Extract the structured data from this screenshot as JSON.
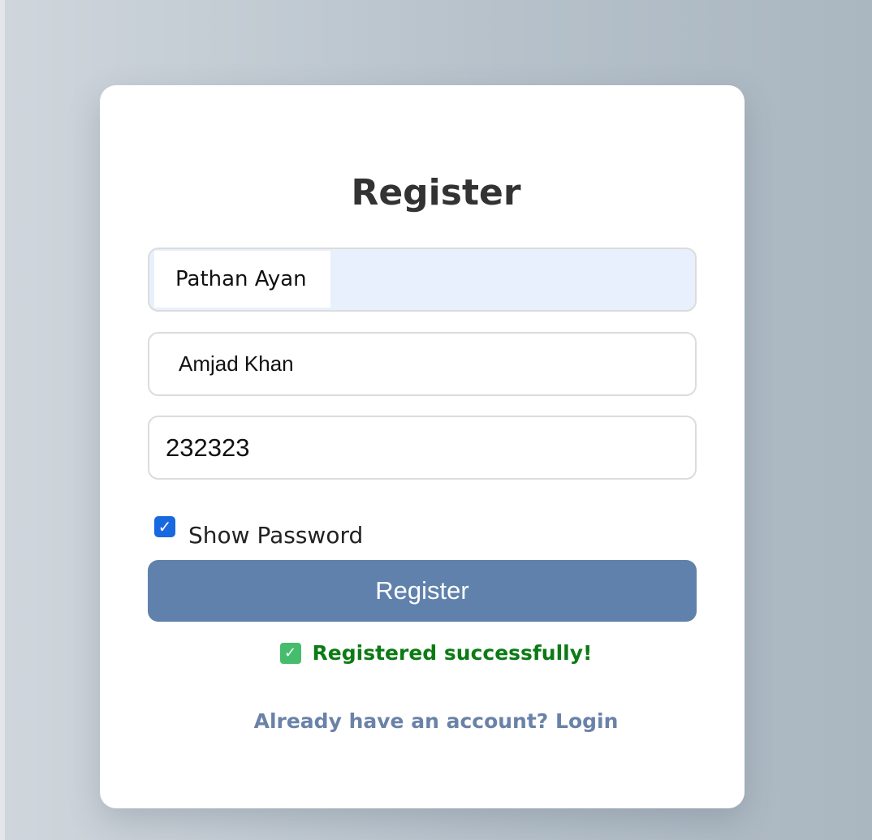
{
  "form": {
    "title": "Register",
    "name_value": "Pathan Ayan",
    "second_name_value": "Amjad Khan",
    "password_value": "232323",
    "show_password_label": "Show Password",
    "show_password_checked": true,
    "submit_label": "Register",
    "success_message": "Registered successfully!",
    "login_link": "Already have an account? Login"
  },
  "icons": {
    "checkbox": "check-icon",
    "success": "check-mark-button-icon"
  },
  "colors": {
    "button": "#5f81ab",
    "success_text": "#0c7a15",
    "link": "#6a82a8",
    "autofill_bg": "#e8f0fe",
    "checkbox": "#1868e0"
  }
}
